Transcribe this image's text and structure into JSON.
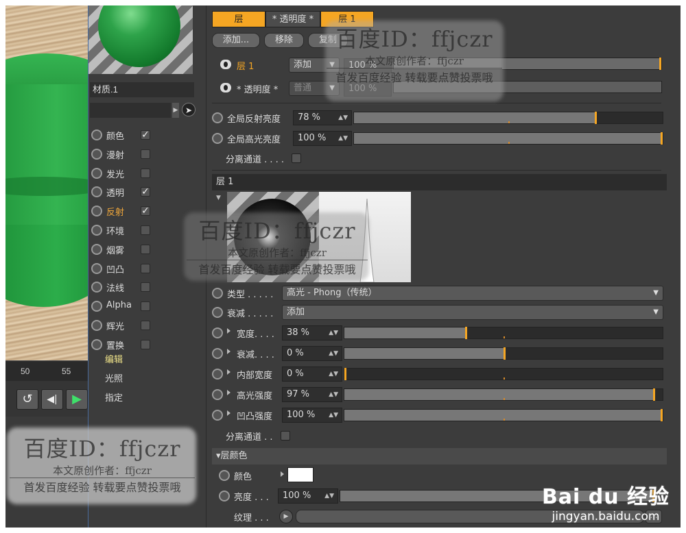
{
  "viewport": {
    "timeline_marks": [
      "50",
      "55"
    ]
  },
  "material": {
    "name": "材质.1",
    "channels": [
      {
        "label": "颜色",
        "checked": true,
        "active": false
      },
      {
        "label": "漫射",
        "checked": false,
        "active": false
      },
      {
        "label": "发光",
        "checked": false,
        "active": false
      },
      {
        "label": "透明",
        "checked": true,
        "active": false
      },
      {
        "label": "反射",
        "checked": true,
        "active": true
      },
      {
        "label": "环境",
        "checked": false,
        "active": false
      },
      {
        "label": "烟雾",
        "checked": false,
        "active": false
      },
      {
        "label": "凹凸",
        "checked": false,
        "active": false
      },
      {
        "label": "法线",
        "checked": false,
        "active": false
      },
      {
        "label": "Alpha",
        "checked": false,
        "active": false
      },
      {
        "label": "辉光",
        "checked": false,
        "active": false
      },
      {
        "label": "置换",
        "checked": false,
        "active": false
      }
    ],
    "links": [
      "编辑",
      "光照",
      "指定"
    ]
  },
  "panel": {
    "tabs": [
      "层",
      "* 透明度 *",
      "层 1"
    ],
    "buttons": [
      "添加...",
      "移除",
      "复制"
    ],
    "layers": [
      {
        "name": "层 1",
        "mode": "添加",
        "value": "100 %"
      },
      {
        "name": "* 透明度 *",
        "mode": "普通",
        "value": "100 %"
      }
    ],
    "global": [
      {
        "label": "全局反射亮度",
        "value": "78 %",
        "fraction": 0.78
      },
      {
        "label": "全局高光亮度",
        "value": "100 %",
        "fraction": 1.0
      }
    ],
    "separate_pass_label": "分离通道 . . . .",
    "layer_header": "层 1",
    "type_label": "类型 . . . . .",
    "type_value": "高光 - Phong（传统）",
    "falloff_label": "衰减 . . . . .",
    "falloff_value": "添加",
    "params": [
      {
        "label": "宽度. . . .",
        "value": "38 %",
        "fraction": 0.38
      },
      {
        "label": "衰减. . . .",
        "value": "0 %",
        "fraction": 0.5
      },
      {
        "label": "内部宽度",
        "value": "0 %",
        "fraction": 0.0
      },
      {
        "label": "高光强度",
        "value": "97 %",
        "fraction": 0.97
      },
      {
        "label": "凹凸强度",
        "value": "100 %",
        "fraction": 1.0
      }
    ],
    "separate_pass_label2": "分离通道 . .",
    "layer_color_header": "▾层颜色",
    "color_label": "颜色",
    "brightness_label": "亮度 . . .",
    "brightness_value": "100 %",
    "brightness_fraction": 1.0,
    "texture_label": "纹理 . . ."
  },
  "watermark": {
    "id_prefix": "百度ID：",
    "id_name": "ffjczr",
    "line2": "本文原创作者：ffjczr",
    "line3": "首发百度经验  转载要点赞投票哦",
    "logo": "Bai du 经验",
    "site": "jingyan.baidu.com"
  },
  "colors": {
    "accent": "#f5a623",
    "panel_bg": "#3c3c3c",
    "bowl_green": "#2ea34a"
  }
}
